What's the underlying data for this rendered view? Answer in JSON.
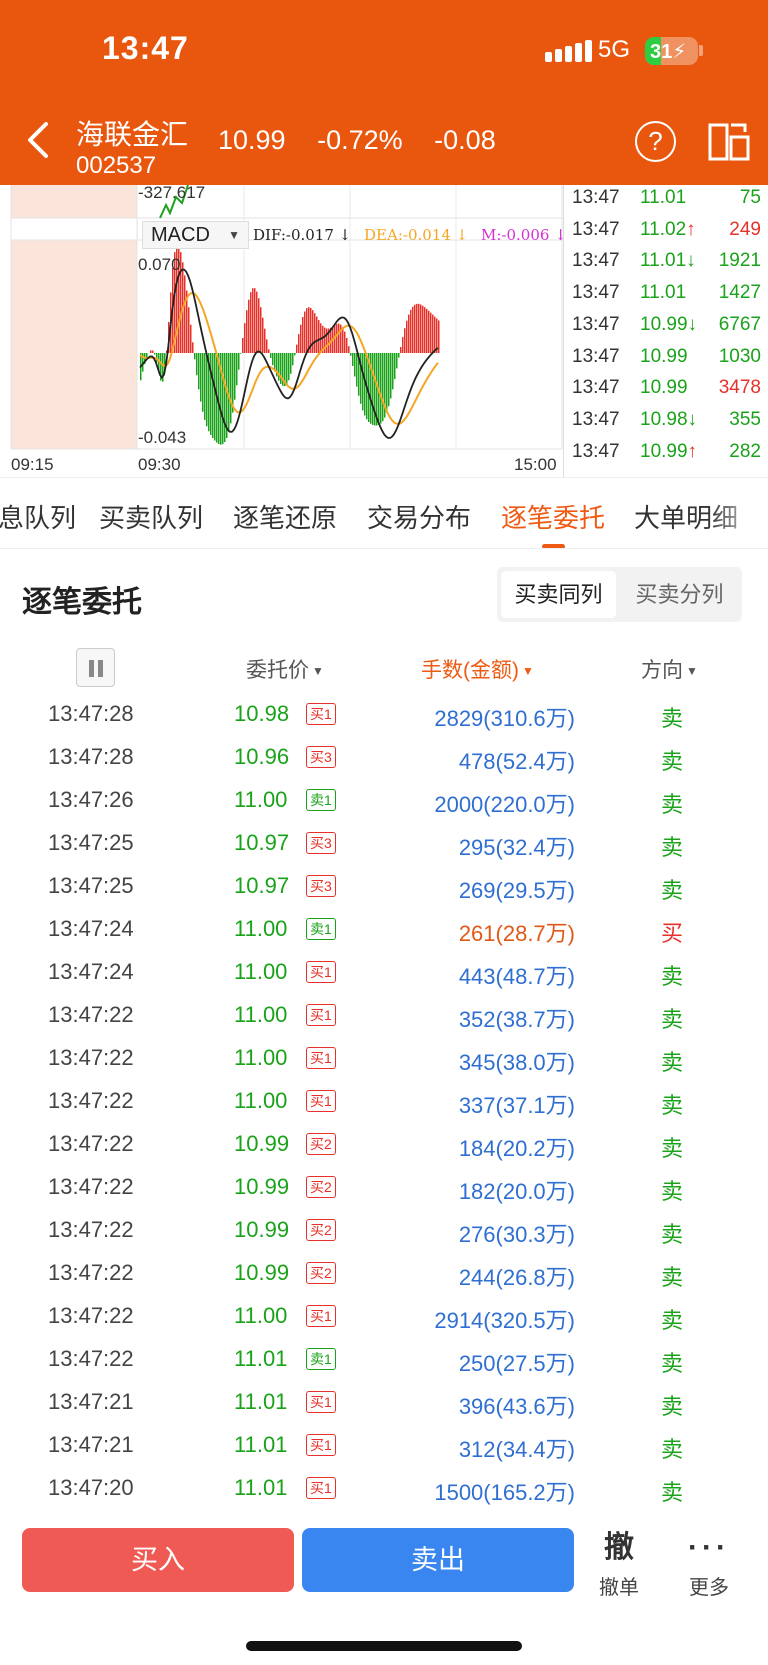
{
  "status_bar": {
    "time": "13:47",
    "network": "5G",
    "battery": "31",
    "battery_level": 0.31
  },
  "header": {
    "stock_name": "海联金汇",
    "stock_code": "002537",
    "price": "10.99",
    "change_pct": "-0.72%",
    "change": "-0.08",
    "help_icon": "question-icon",
    "switch_icon": "landscape-switch-icon",
    "back_icon": "chevron-left-icon"
  },
  "chart": {
    "top_value": "-327.617",
    "indicator": "MACD",
    "dif": "DIF:-0.017 ↓",
    "dea": "DEA:-0.014 ↓",
    "m": "M:-0.006 ↓",
    "y_max": "0.070",
    "y_min": "-0.043",
    "x_start": "09:15",
    "x_open": "09:30",
    "x_end": "15:00",
    "colors": {
      "up": "#e8302a",
      "down": "#1aa31a",
      "dif_line": "#222222",
      "dea_line": "#f5a623",
      "m_text": "#d62fd6"
    }
  },
  "ticks": [
    {
      "time": "13:47",
      "price": "11.01",
      "arrow": "",
      "vol": "75",
      "vol_color": "green"
    },
    {
      "time": "13:47",
      "price": "11.02",
      "arrow": "↑",
      "vol": "249",
      "vol_color": "red"
    },
    {
      "time": "13:47",
      "price": "11.01",
      "arrow": "↓",
      "vol": "1921",
      "vol_color": "green"
    },
    {
      "time": "13:47",
      "price": "11.01",
      "arrow": "",
      "vol": "1427",
      "vol_color": "green"
    },
    {
      "time": "13:47",
      "price": "10.99",
      "arrow": "↓",
      "vol": "6767",
      "vol_color": "green"
    },
    {
      "time": "13:47",
      "price": "10.99",
      "arrow": "",
      "vol": "1030",
      "vol_color": "green"
    },
    {
      "time": "13:47",
      "price": "10.99",
      "arrow": "",
      "vol": "3478",
      "vol_color": "red"
    },
    {
      "time": "13:47",
      "price": "10.98",
      "arrow": "↓",
      "vol": "355",
      "vol_color": "green"
    },
    {
      "time": "13:47",
      "price": "10.99",
      "arrow": "↑",
      "vol": "282",
      "vol_color": "green"
    }
  ],
  "tabs": [
    {
      "label": "息队列",
      "active": false
    },
    {
      "label": "买卖队列",
      "active": false
    },
    {
      "label": "逐笔还原",
      "active": false
    },
    {
      "label": "交易分布",
      "active": false
    },
    {
      "label": "逐笔委托",
      "active": true
    },
    {
      "label": "大单明细",
      "active": false
    }
  ],
  "section": {
    "title": "逐笔委托",
    "seg_on": "买卖同列",
    "seg_off": "买卖分列",
    "col_price": "委托价",
    "col_amount": "手数(金额)",
    "col_dir": "方向"
  },
  "orders": [
    {
      "time": "13:47:28",
      "price": "10.98",
      "tag": "买1",
      "tag_type": "buy",
      "amount": "2829(310.6万)",
      "dir": "卖"
    },
    {
      "time": "13:47:28",
      "price": "10.96",
      "tag": "买3",
      "tag_type": "buy",
      "amount": "478(52.4万)",
      "dir": "卖"
    },
    {
      "time": "13:47:26",
      "price": "11.00",
      "tag": "卖1",
      "tag_type": "sell",
      "amount": "2000(220.0万)",
      "dir": "卖"
    },
    {
      "time": "13:47:25",
      "price": "10.97",
      "tag": "买3",
      "tag_type": "buy",
      "amount": "295(32.4万)",
      "dir": "卖"
    },
    {
      "time": "13:47:25",
      "price": "10.97",
      "tag": "买3",
      "tag_type": "buy",
      "amount": "269(29.5万)",
      "dir": "卖"
    },
    {
      "time": "13:47:24",
      "price": "11.00",
      "tag": "卖1",
      "tag_type": "sell",
      "amount": "261(28.7万)",
      "dir": "买"
    },
    {
      "time": "13:47:24",
      "price": "11.00",
      "tag": "买1",
      "tag_type": "buy",
      "amount": "443(48.7万)",
      "dir": "卖"
    },
    {
      "time": "13:47:22",
      "price": "11.00",
      "tag": "买1",
      "tag_type": "buy",
      "amount": "352(38.7万)",
      "dir": "卖"
    },
    {
      "time": "13:47:22",
      "price": "11.00",
      "tag": "买1",
      "tag_type": "buy",
      "amount": "345(38.0万)",
      "dir": "卖"
    },
    {
      "time": "13:47:22",
      "price": "11.00",
      "tag": "买1",
      "tag_type": "buy",
      "amount": "337(37.1万)",
      "dir": "卖"
    },
    {
      "time": "13:47:22",
      "price": "10.99",
      "tag": "买2",
      "tag_type": "buy",
      "amount": "184(20.2万)",
      "dir": "卖"
    },
    {
      "time": "13:47:22",
      "price": "10.99",
      "tag": "买2",
      "tag_type": "buy",
      "amount": "182(20.0万)",
      "dir": "卖"
    },
    {
      "time": "13:47:22",
      "price": "10.99",
      "tag": "买2",
      "tag_type": "buy",
      "amount": "276(30.3万)",
      "dir": "卖"
    },
    {
      "time": "13:47:22",
      "price": "10.99",
      "tag": "买2",
      "tag_type": "buy",
      "amount": "244(26.8万)",
      "dir": "卖"
    },
    {
      "time": "13:47:22",
      "price": "11.00",
      "tag": "买1",
      "tag_type": "buy",
      "amount": "2914(320.5万)",
      "dir": "卖"
    },
    {
      "time": "13:47:22",
      "price": "11.01",
      "tag": "卖1",
      "tag_type": "sell",
      "amount": "250(27.5万)",
      "dir": "卖"
    },
    {
      "time": "13:47:21",
      "price": "11.01",
      "tag": "买1",
      "tag_type": "buy",
      "amount": "396(43.6万)",
      "dir": "卖"
    },
    {
      "time": "13:47:21",
      "price": "11.01",
      "tag": "买1",
      "tag_type": "buy",
      "amount": "312(34.4万)",
      "dir": "卖"
    },
    {
      "time": "13:47:20",
      "price": "11.01",
      "tag": "买1",
      "tag_type": "buy",
      "amount": "1500(165.2万)",
      "dir": "卖"
    }
  ],
  "bottom": {
    "buy": "买入",
    "sell": "卖出",
    "cancel_icon": "撤",
    "cancel_label": "撤单",
    "more_icon": "···",
    "more_label": "更多"
  }
}
